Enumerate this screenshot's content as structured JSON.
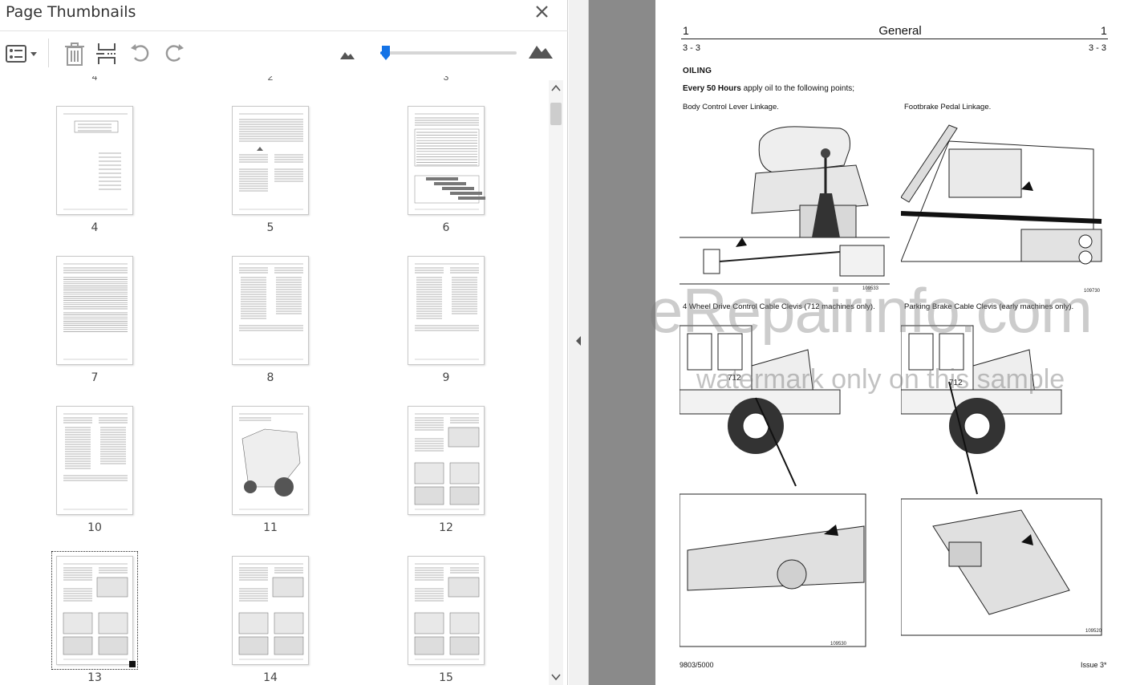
{
  "panel": {
    "title": "Page Thumbnails",
    "close_icon": "close-icon",
    "toolbar": {
      "options_icon": "thumbnail-options-icon",
      "delete_icon": "trash-icon",
      "insert_icon": "insert-page-icon",
      "undo_icon": "undo-icon",
      "redo_icon": "redo-icon",
      "zoom_out_icon": "small-mountain-icon",
      "zoom_in_icon": "large-mountain-icon",
      "zoom_level": 0.04
    },
    "partial_labels": [
      "4",
      "2",
      "3"
    ],
    "thumbnails": [
      {
        "label": "4",
        "type": "index"
      },
      {
        "label": "5",
        "type": "text"
      },
      {
        "label": "6",
        "type": "table"
      },
      {
        "label": "7",
        "type": "table-small"
      },
      {
        "label": "8",
        "type": "list"
      },
      {
        "label": "9",
        "type": "list"
      },
      {
        "label": "10",
        "type": "list"
      },
      {
        "label": "11",
        "type": "machine"
      },
      {
        "label": "12",
        "type": "diagram"
      },
      {
        "label": "13",
        "type": "diagram",
        "selected": true
      },
      {
        "label": "14",
        "type": "diagram"
      },
      {
        "label": "15",
        "type": "diagram"
      }
    ]
  },
  "document": {
    "header_left": "1",
    "header_title": "General",
    "header_right": "1",
    "sub_left": "3 - 3",
    "sub_right": "3 - 3",
    "section": "OILING",
    "intro_bold": "Every 50 Hours",
    "intro_rest": " apply oil to the following points;",
    "caption_1": "Body Control Lever Linkage.",
    "caption_2": "Footbrake Pedal Linkage.",
    "caption_3": "4 Wheel Drive Control Cable Clevis (712 machines only).",
    "caption_4": "Parking Brake Cable Clevis (early machines only).",
    "ref_1": "109533",
    "ref_2": "109730",
    "ref_3": "109530",
    "ref_4": "109520",
    "machine_1": "712",
    "machine_2": "712",
    "footer_left": "9803/5000",
    "footer_right": "Issue 3*"
  },
  "watermark": {
    "main": "eRepairinfo.com",
    "sub": "watermark only on this sample"
  }
}
